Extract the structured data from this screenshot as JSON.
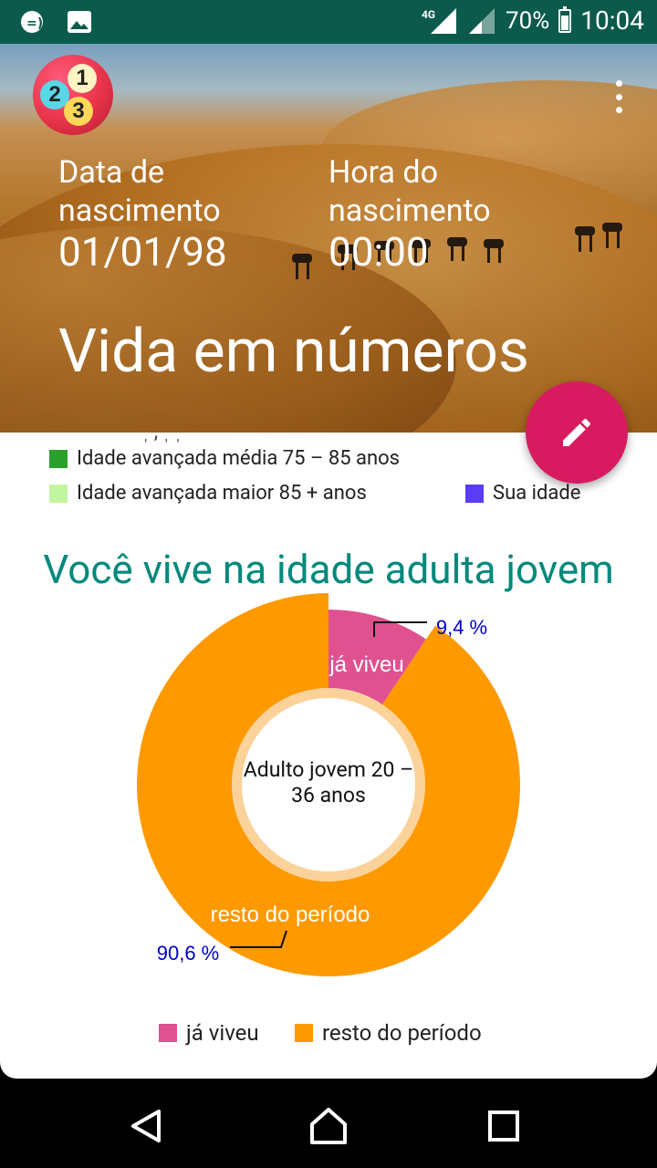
{
  "status_bar": {
    "network": "4G",
    "battery": "70%",
    "time": "10:04"
  },
  "header": {
    "birth_date_label": "Data de nascimento",
    "birth_date": "01/01/98",
    "birth_time_label": "Hora do nascimento",
    "birth_time": "00:00",
    "title": "Vida em números",
    "logo_digits": [
      "1",
      "2",
      "3"
    ]
  },
  "legend": {
    "items": [
      {
        "label": "Idade avançada média 75 – 85 anos",
        "color": "#2ca02c"
      },
      {
        "label": "Idade avançada maior 85 + anos",
        "color": "#c2f5a0"
      },
      {
        "label": "Sua idade",
        "color": "#5b3cf5"
      }
    ]
  },
  "section": {
    "heading": "Você vive na idade adulta jovem"
  },
  "chart_data": {
    "type": "pie",
    "style": "donut",
    "center_label": "Adulto jovem 20 – 36 anos",
    "series": [
      {
        "name": "já viveu",
        "value": 9.4,
        "value_label": "9,4 %",
        "color": "#e05190"
      },
      {
        "name": "resto do período",
        "value": 90.6,
        "value_label": "90,6 %",
        "color": "#ff9900"
      }
    ],
    "legend_position": "bottom"
  },
  "colors": {
    "status_bar": "#0b5a4c",
    "fab": "#d81b60",
    "heading": "#00897b",
    "value_label": "#0000cc"
  }
}
